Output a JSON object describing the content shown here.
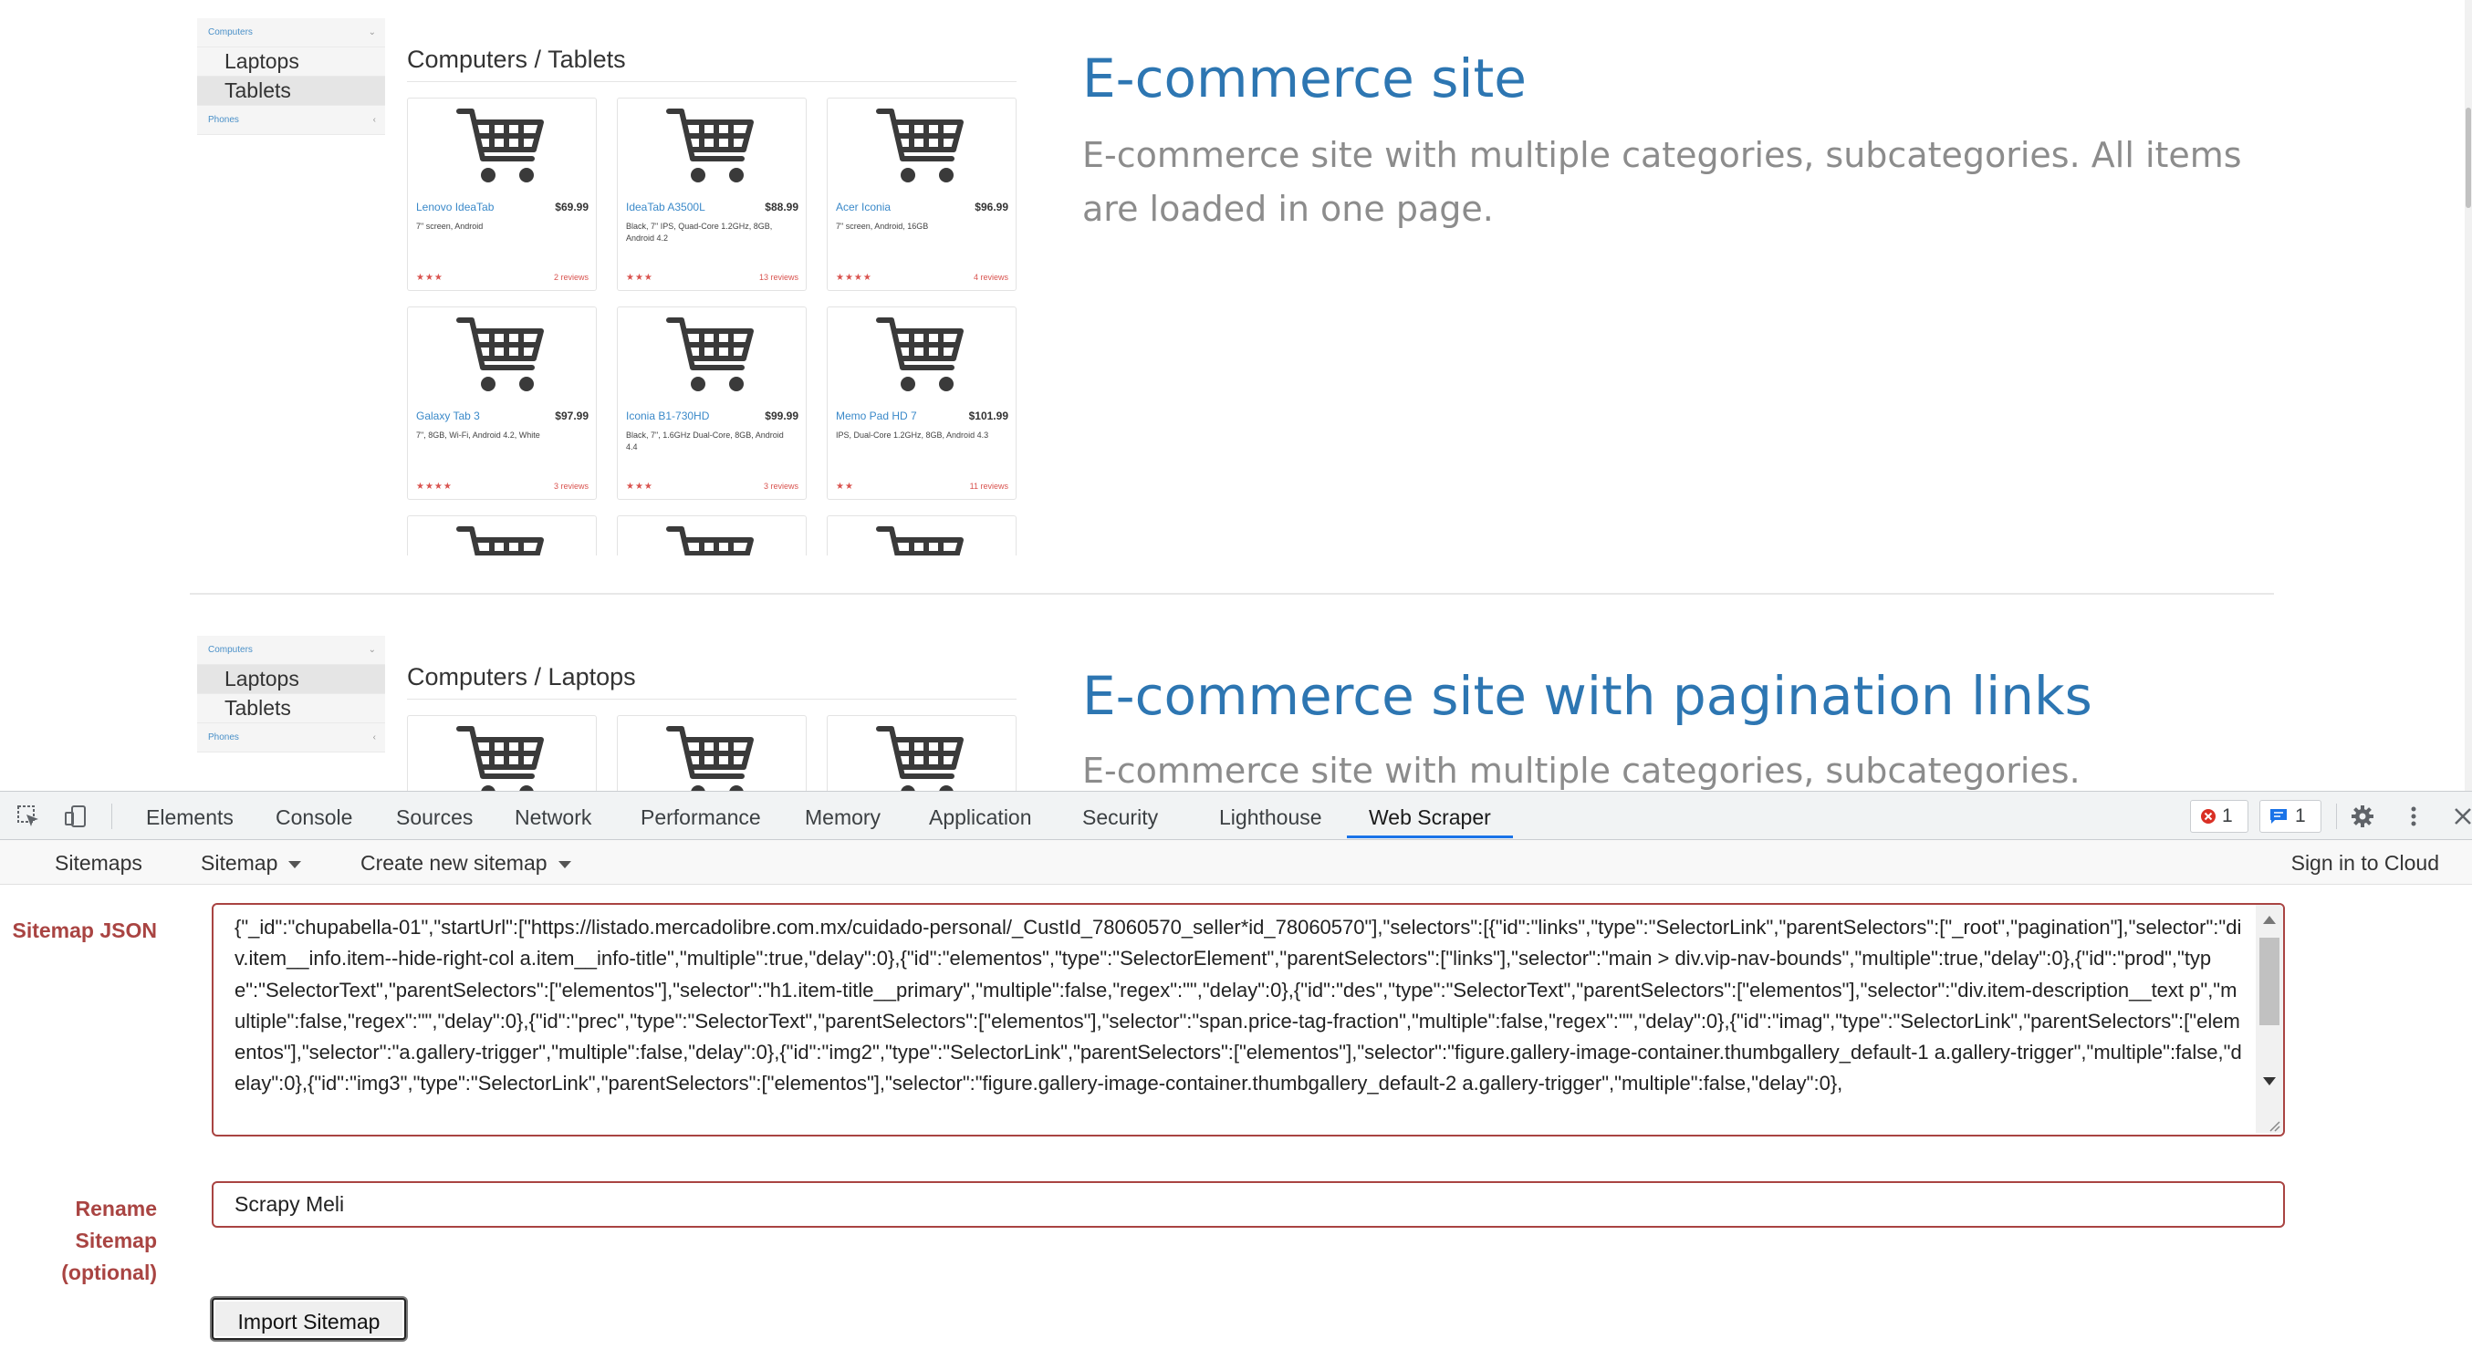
{
  "website": {
    "sections": [
      {
        "thumbnail": {
          "sidebar": [
            {
              "label": "Computers",
              "sub": false,
              "active": false,
              "chevron": "⌄"
            },
            {
              "label": "Laptops",
              "sub": true,
              "active": false,
              "chevron": ""
            },
            {
              "label": "Tablets",
              "sub": true,
              "active": true,
              "chevron": ""
            },
            {
              "label": "Phones",
              "sub": false,
              "active": false,
              "chevron": "‹"
            }
          ],
          "heading": "Computers / Tablets",
          "products": [
            {
              "name": "Lenovo IdeaTab",
              "price": "$69.99",
              "desc": "7\" screen, Android",
              "stars": "★★★",
              "reviews": "2 reviews"
            },
            {
              "name": "IdeaTab A3500L",
              "price": "$88.99",
              "desc": "Black, 7\" IPS, Quad-Core 1.2GHz, 8GB, Android 4.2",
              "stars": "★★★",
              "reviews": "13 reviews"
            },
            {
              "name": "Acer Iconia",
              "price": "$96.99",
              "desc": "7\" screen, Android, 16GB",
              "stars": "★★★★",
              "reviews": "4 reviews"
            },
            {
              "name": "Galaxy Tab 3",
              "price": "$97.99",
              "desc": "7\", 8GB, Wi-Fi, Android 4.2, White",
              "stars": "★★★★",
              "reviews": "3 reviews"
            },
            {
              "name": "Iconia B1-730HD",
              "price": "$99.99",
              "desc": "Black, 7\", 1.6GHz Dual-Core, 8GB, Android 4.4",
              "stars": "★★★",
              "reviews": "3 reviews"
            },
            {
              "name": "Memo Pad HD 7",
              "price": "$101.99",
              "desc": "IPS, Dual-Core 1.2GHz, 8GB, Android 4.3",
              "stars": "★★",
              "reviews": "11 reviews"
            }
          ]
        },
        "title": "E-commerce site",
        "description": "E-commerce site with multiple categories, subcategories. All items are loaded in one page."
      },
      {
        "thumbnail": {
          "sidebar": [
            {
              "label": "Computers",
              "sub": false,
              "active": false,
              "chevron": "⌄"
            },
            {
              "label": "Laptops",
              "sub": true,
              "active": true,
              "chevron": ""
            },
            {
              "label": "Tablets",
              "sub": true,
              "active": false,
              "chevron": ""
            },
            {
              "label": "Phones",
              "sub": false,
              "active": false,
              "chevron": "‹"
            }
          ],
          "heading": "Computers / Laptops"
        },
        "title": "E-commerce site with pagination links",
        "description": "E-commerce site with multiple categories, subcategories."
      }
    ]
  },
  "devtools": {
    "tabs": [
      "Elements",
      "Console",
      "Sources",
      "Network",
      "Performance",
      "Memory",
      "Application",
      "Security",
      "Lighthouse",
      "Web Scraper"
    ],
    "active_tab": "Web Scraper",
    "error_count": "1",
    "message_count": "1",
    "icons": [
      "inspect-element-icon",
      "device-toolbar-icon",
      "error-icon",
      "message-icon",
      "settings-gear-icon",
      "more-options-icon",
      "close-icon"
    ],
    "accent_color": "#1a73e8"
  },
  "web_scraper": {
    "nav": {
      "sitemaps": "Sitemaps",
      "sitemap": "Sitemap",
      "create_new": "Create new sitemap",
      "sign_in": "Sign in to Cloud"
    },
    "sitemap_json_label": "Sitemap JSON",
    "sitemap_json_value": "{\"_id\":\"chupabella-01\",\"startUrl\":[\"https://listado.mercadolibre.com.mx/cuidado-personal/_CustId_78060570_seller*id_78060570\"],\"selectors\":[{\"id\":\"links\",\"type\":\"SelectorLink\",\"parentSelectors\":[\"_root\",\"pagination\"],\"selector\":\"div.item__info.item--hide-right-col a.item__info-title\",\"multiple\":true,\"delay\":0},{\"id\":\"elementos\",\"type\":\"SelectorElement\",\"parentSelectors\":[\"links\"],\"selector\":\"main > div.vip-nav-bounds\",\"multiple\":true,\"delay\":0},{\"id\":\"prod\",\"type\":\"SelectorText\",\"parentSelectors\":[\"elementos\"],\"selector\":\"h1.item-title__primary\",\"multiple\":false,\"regex\":\"\",\"delay\":0},{\"id\":\"des\",\"type\":\"SelectorText\",\"parentSelectors\":[\"elementos\"],\"selector\":\"div.item-description__text p\",\"multiple\":false,\"regex\":\"\",\"delay\":0},{\"id\":\"prec\",\"type\":\"SelectorText\",\"parentSelectors\":[\"elementos\"],\"selector\":\"span.price-tag-fraction\",\"multiple\":false,\"regex\":\"\",\"delay\":0},{\"id\":\"imag\",\"type\":\"SelectorLink\",\"parentSelectors\":[\"elementos\"],\"selector\":\"a.gallery-trigger\",\"multiple\":false,\"delay\":0},{\"id\":\"img2\",\"type\":\"SelectorLink\",\"parentSelectors\":[\"elementos\"],\"selector\":\"figure.gallery-image-container.thumbgallery_default-1 a.gallery-trigger\",\"multiple\":false,\"delay\":0},{\"id\":\"img3\",\"type\":\"SelectorLink\",\"parentSelectors\":[\"elementos\"],\"selector\":\"figure.gallery-image-container.thumbgallery_default-2 a.gallery-trigger\",\"multiple\":false,\"delay\":0},",
    "rename_label_lines": [
      "Rename",
      "Sitemap",
      "(optional)"
    ],
    "rename_value": "Scrapy Meli",
    "import_button": "Import Sitemap",
    "error_color": "#a94442"
  }
}
